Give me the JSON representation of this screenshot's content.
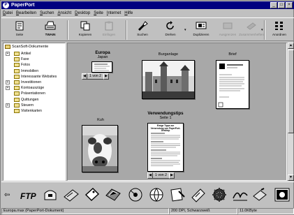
{
  "window": {
    "title": "PaperPort",
    "app_icon_letter": "P",
    "minimize": "_",
    "maximize": "□",
    "close": "×"
  },
  "menu": [
    "Datei",
    "Bearbeiten",
    "Suchen",
    "Ansicht",
    "Desktop",
    "Seite",
    "Internet",
    "Hilfe"
  ],
  "toolbar": {
    "seite": "Seite",
    "twain": "TWAIN",
    "kopieren": "Kopieren",
    "einfuegen": "Einfügen",
    "suchen": "Suchen",
    "drehen": "Drehen",
    "duplizieren": "Duplizieren",
    "disabled1": "Ausgrenzen",
    "disabled2": "Zusammenheften",
    "anordnen": "Anordnen"
  },
  "tree": {
    "root": "ScanSoft-Dokumente",
    "items": [
      {
        "label": "Artikel",
        "expand": "+"
      },
      {
        "label": "Faxe",
        "expand": ""
      },
      {
        "label": "Fotos",
        "expand": ""
      },
      {
        "label": "Immobilien",
        "expand": ""
      },
      {
        "label": "Interessante Websites",
        "expand": ""
      },
      {
        "label": "Investitionen",
        "expand": "+"
      },
      {
        "label": "Kontoauszüge",
        "expand": "+"
      },
      {
        "label": "Präsentationen",
        "expand": ""
      },
      {
        "label": "Quittungen",
        "expand": ""
      },
      {
        "label": "Steuern",
        "expand": "+"
      },
      {
        "label": "Visitenkarten",
        "expand": ""
      }
    ]
  },
  "items": {
    "europa": {
      "title": "Europa",
      "sub": "Japan",
      "nav": "1 von 2"
    },
    "burg": {
      "title": "Burganlage"
    },
    "brief": {
      "title": "Brief"
    },
    "kuh": {
      "title": "Kuh"
    },
    "tips": {
      "title": "Verwendungstips",
      "sub": "Seite 1",
      "nav": "1 von 2",
      "doc_heading": "Einige Tipps zur Verwendung von PaperPort-Desktop"
    }
  },
  "status": {
    "file": "Europa.max (PaperPort-Dokument)",
    "dpi": "200 DPI, Schwarzweiß",
    "size": "11.0KByte"
  }
}
